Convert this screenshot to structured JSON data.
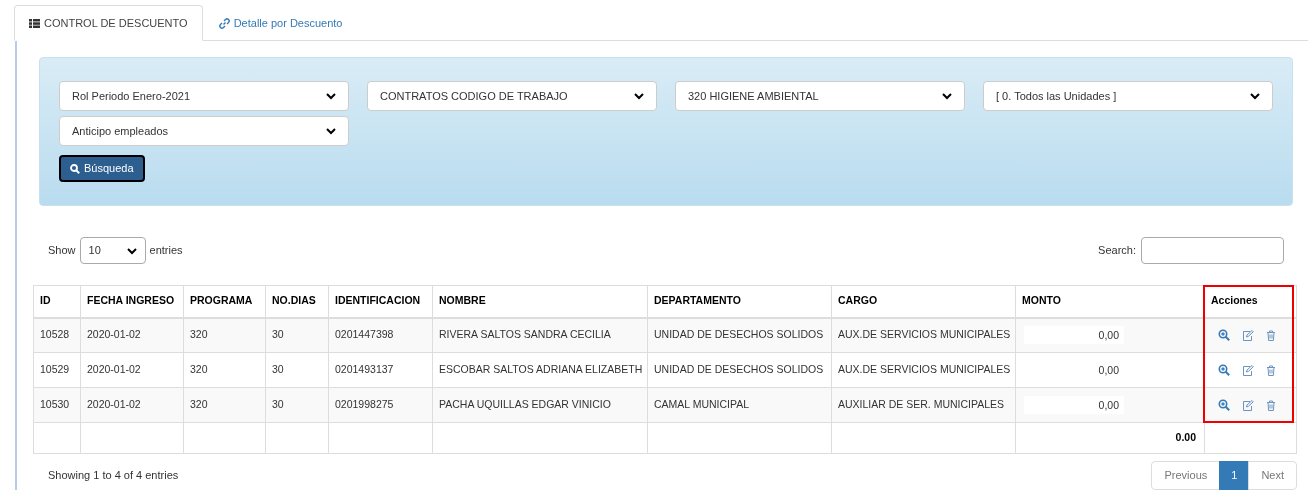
{
  "tabs": [
    {
      "label": "CONTROL DE DESCUENTO",
      "selected": true
    },
    {
      "label": "Detalle por Descuento",
      "selected": false
    }
  ],
  "filters": [
    {
      "value": "Rol Periodo Enero-2021"
    },
    {
      "value": "CONTRATOS CODIGO DE TRABAJO"
    },
    {
      "value": "320 HIGIENE AMBIENTAL"
    },
    {
      "value": "[ 0. Todos las Unidades ]"
    },
    {
      "value": "Anticipo empleados"
    }
  ],
  "search_button": "Búsqueda",
  "length": {
    "show": "Show",
    "value": "10",
    "entries": "entries"
  },
  "search": {
    "label": "Search:"
  },
  "table": {
    "columns": [
      "ID",
      "FECHA INGRESO",
      "PROGRAMA",
      "NO.DIAS",
      "IDENTIFICACION",
      "NOMBRE",
      "DEPARTAMENTO",
      "CARGO",
      "MONTO",
      "Acciones"
    ],
    "rows": [
      {
        "cells": [
          "10528",
          "2020-01-02",
          "320",
          "30",
          "0201447398",
          "RIVERA SALTOS SANDRA CECILIA",
          "UNIDAD DE DESECHOS SOLIDOS",
          "AUX.DE SERVICIOS MUNICIPALES"
        ],
        "monto": "0,00"
      },
      {
        "cells": [
          "10529",
          "2020-01-02",
          "320",
          "30",
          "0201493137",
          "ESCOBAR SALTOS ADRIANA ELIZABETH",
          "UNIDAD DE DESECHOS SOLIDOS",
          "AUX.DE SERVICIOS MUNICIPALES"
        ],
        "monto": "0,00"
      },
      {
        "cells": [
          "10530",
          "2020-01-02",
          "320",
          "30",
          "0201998275",
          "PACHA UQUILLAS EDGAR VINICIO",
          "CAMAL MUNICIPAL",
          "AUXILIAR DE SER. MUNICIPALES"
        ],
        "monto": "0,00"
      }
    ],
    "total": "0.00"
  },
  "info": "Showing 1 to 4 of 4 entries",
  "pagination": [
    {
      "label": "Previous",
      "kind": "prev",
      "selected": false
    },
    {
      "label": "1",
      "kind": "page",
      "selected": true
    },
    {
      "label": "Next",
      "kind": "next",
      "selected": false
    }
  ]
}
